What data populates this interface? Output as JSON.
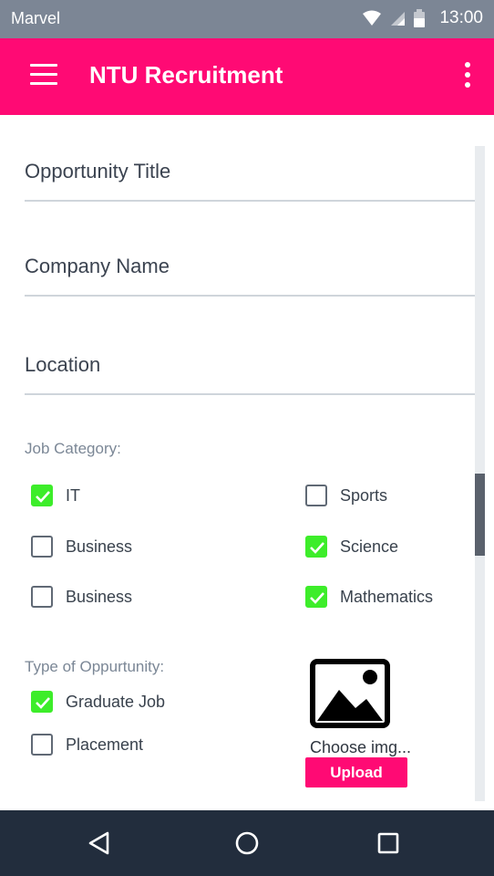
{
  "status_bar": {
    "carrier": "Marvel",
    "time": "13:00"
  },
  "app_bar": {
    "title": "NTU Recruitment"
  },
  "form": {
    "fields": {
      "opportunity_title": {
        "placeholder": "Opportunity Title",
        "value": ""
      },
      "company_name": {
        "placeholder": "Company Name",
        "value": ""
      },
      "location": {
        "placeholder": "Location",
        "value": ""
      }
    },
    "job_category_label": "Job Category:",
    "job_categories": [
      {
        "label": "IT",
        "checked": true
      },
      {
        "label": "Sports",
        "checked": false
      },
      {
        "label": "Business",
        "checked": false
      },
      {
        "label": "Science",
        "checked": true
      },
      {
        "label": "Business",
        "checked": false
      },
      {
        "label": "Mathematics",
        "checked": true
      }
    ],
    "opportunity_type_label": "Type of Oppurtunity:",
    "opportunity_types": [
      {
        "label": "Graduate Job",
        "checked": true
      },
      {
        "label": "Placement",
        "checked": false
      }
    ],
    "image": {
      "choose_label": "Choose img...",
      "upload_label": "Upload"
    }
  },
  "colors": {
    "accent": "#ff0a74",
    "checked": "#3ded2a",
    "status_bar": "#7c8695",
    "nav_bar": "#222d3d"
  },
  "icons": {
    "menu": "hamburger-menu-icon",
    "more": "more-vertical-icon",
    "image": "image-placeholder-icon",
    "nav_back": "back-triangle-icon",
    "nav_home": "home-circle-icon",
    "nav_recents": "recents-square-icon"
  }
}
